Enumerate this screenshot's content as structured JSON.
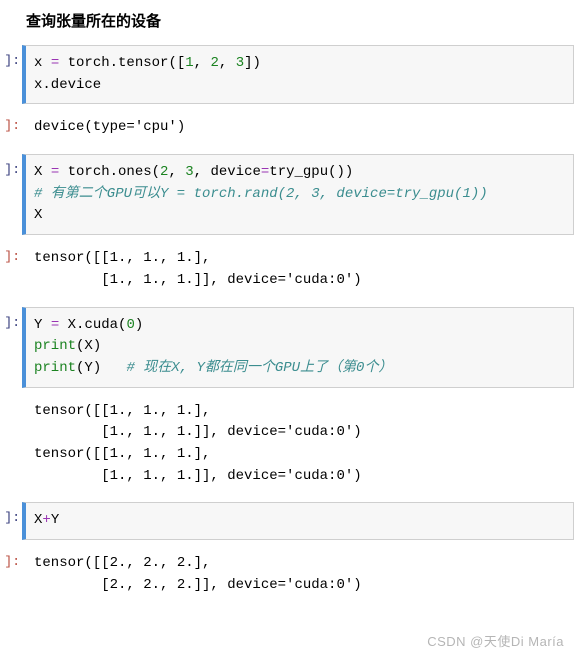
{
  "heading": "查询张量所在的设备",
  "gutter": {
    "in": "]:",
    "out": "]:"
  },
  "cell1": {
    "l1a": "x ",
    "l1b": "=",
    "l1c": " torch.",
    "l1d": "tensor([",
    "l1e": "1",
    "l1f": ", ",
    "l1g": "2",
    "l1h": ", ",
    "l1i": "3",
    "l1j": "])",
    "l2": "x.device"
  },
  "out1": "device(type='cpu')",
  "cell2": {
    "l1a": "X ",
    "l1b": "=",
    "l1c": " torch.",
    "l1d": "ones(",
    "l1e": "2",
    "l1f": ", ",
    "l1g": "3",
    "l1h": ", device",
    "l1i": "=",
    "l1j": "try_gpu())",
    "l2": "# 有第二个GPU可以Y = torch.rand(2, 3, device=try_gpu(1))",
    "l3": "X"
  },
  "out2": {
    "l1": "tensor([[1., 1., 1.],",
    "l2": "        [1., 1., 1.]], device='cuda:0')"
  },
  "cell3": {
    "l1a": "Y ",
    "l1b": "=",
    "l1c": " X.",
    "l1d": "cuda(",
    "l1e": "0",
    "l1f": ")",
    "l2a": "print",
    "l2b": "(X)",
    "l3a": "print",
    "l3b": "(Y)   ",
    "l3c": "# 现在X, Y都在同一个GPU上了（第0个）"
  },
  "out3": {
    "l1": "tensor([[1., 1., 1.],",
    "l2": "        [1., 1., 1.]], device='cuda:0')",
    "l3": "tensor([[1., 1., 1.],",
    "l4": "        [1., 1., 1.]], device='cuda:0')"
  },
  "cell4": {
    "l1a": "X",
    "l1b": "+",
    "l1c": "Y"
  },
  "out4": {
    "l1": "tensor([[2., 2., 2.],",
    "l2": "        [2., 2., 2.]], device='cuda:0')"
  },
  "watermark": "CSDN @天使Di María"
}
